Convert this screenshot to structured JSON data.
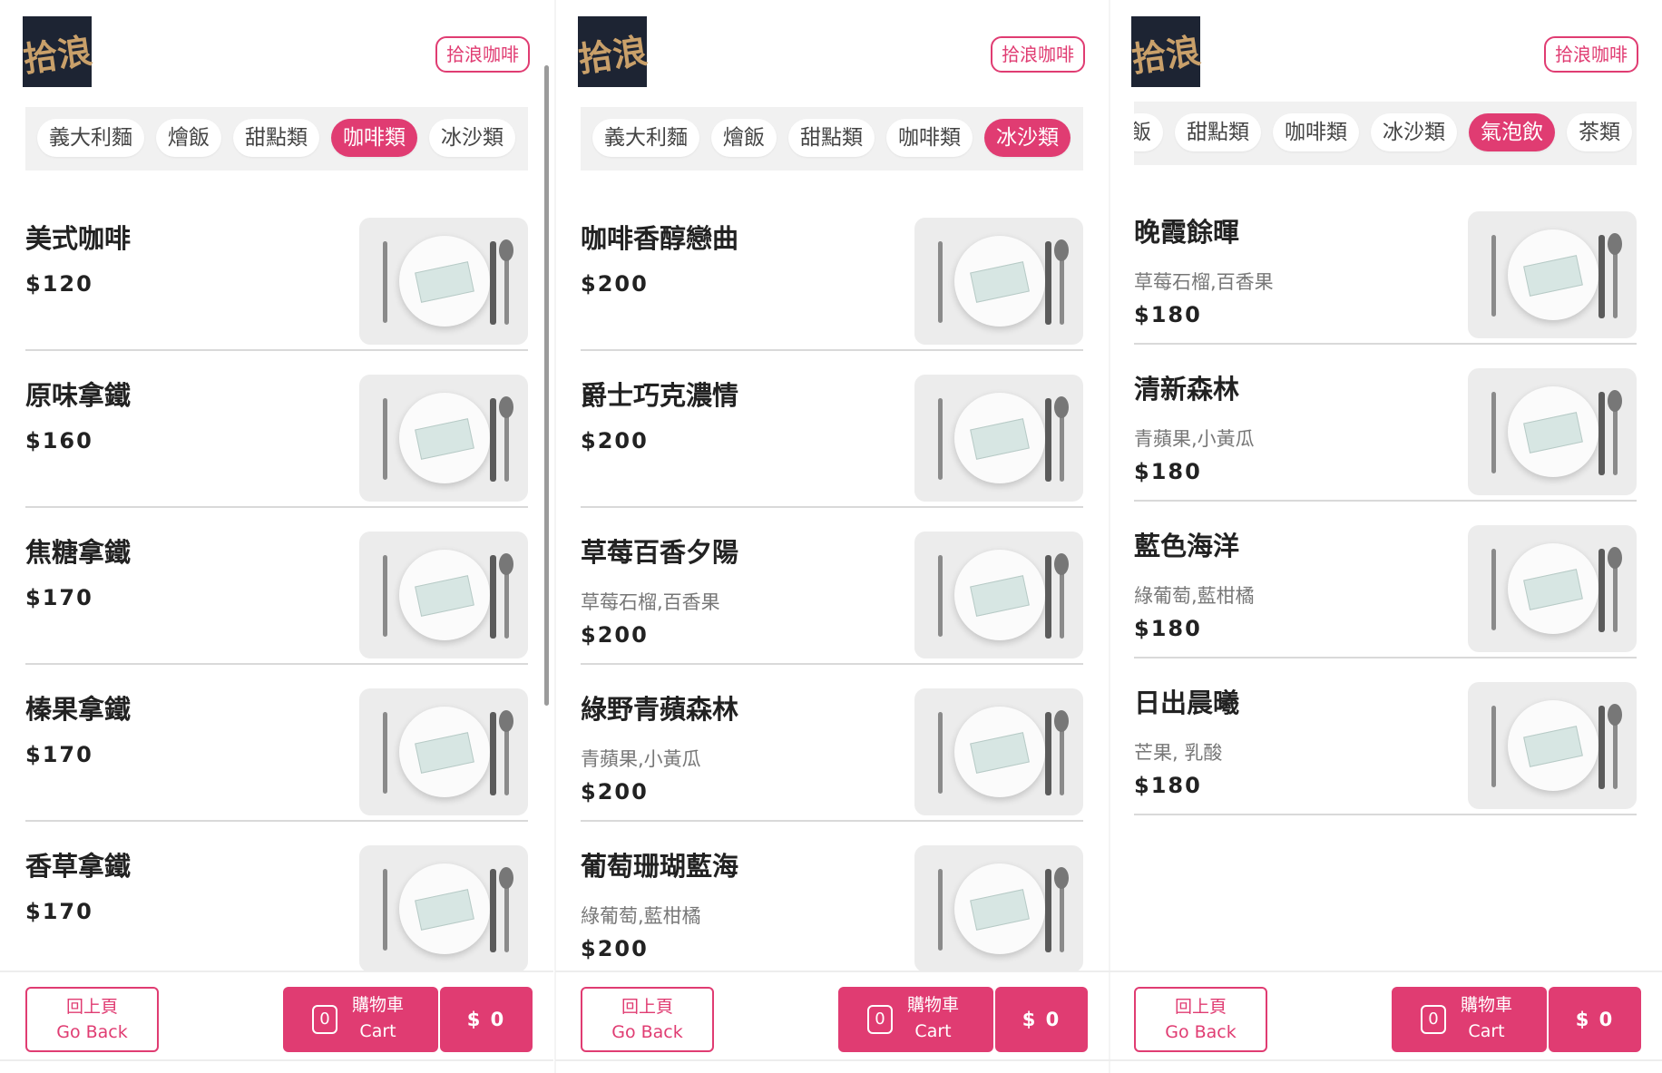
{
  "header": {
    "logo_text": "拾浪",
    "brand": "拾浪咖啡"
  },
  "footer": {
    "back_zh": "回上頁",
    "back_en": "Go Back",
    "cart_count": "0",
    "cart_zh": "購物車",
    "cart_en": "Cart",
    "total": "$ 0"
  },
  "screen1": {
    "categories": [
      "義大利麵",
      "燴飯",
      "甜點類",
      "咖啡類",
      "冰沙類"
    ],
    "active_category": "咖啡類",
    "items": [
      {
        "name": "美式咖啡",
        "price": "$120"
      },
      {
        "name": "原味拿鐵",
        "price": "$160"
      },
      {
        "name": "焦糖拿鐵",
        "price": "$170"
      },
      {
        "name": "榛果拿鐵",
        "price": "$170"
      },
      {
        "name": "香草拿鐵",
        "price": "$170"
      }
    ]
  },
  "screen2": {
    "categories": [
      "義大利麵",
      "燴飯",
      "甜點類",
      "咖啡類",
      "冰沙類"
    ],
    "active_category": "冰沙類",
    "items": [
      {
        "name": "咖啡香醇戀曲",
        "desc": "",
        "price": "$200"
      },
      {
        "name": "爵士巧克濃情",
        "desc": "",
        "price": "$200"
      },
      {
        "name": "草莓百香夕陽",
        "desc": "草莓石榴,百香果",
        "price": "$200"
      },
      {
        "name": "綠野青蘋森林",
        "desc": "青蘋果,小黃瓜",
        "price": "$200"
      },
      {
        "name": "葡萄珊瑚藍海",
        "desc": "綠葡萄,藍柑橘",
        "price": "$200"
      }
    ]
  },
  "screen3": {
    "categories": [
      "飯",
      "甜點類",
      "咖啡類",
      "冰沙類",
      "氣泡飲",
      "茶類"
    ],
    "active_category": "氣泡飲",
    "items": [
      {
        "name": "晚霞餘暉",
        "desc": "草莓石榴,百香果",
        "price": "$180"
      },
      {
        "name": "清新森林",
        "desc": "青蘋果,小黃瓜",
        "price": "$180"
      },
      {
        "name": "藍色海洋",
        "desc": "綠葡萄,藍柑橘",
        "price": "$180"
      },
      {
        "name": "日出晨曦",
        "desc": "芒果, 乳酸",
        "price": "$180"
      }
    ]
  },
  "colors": {
    "accent": "#e03c72",
    "logo_bg": "#1d2433",
    "logo_fg": "#c9a06a"
  },
  "icons": {
    "thumbnail": "plate-cutlery-image"
  }
}
